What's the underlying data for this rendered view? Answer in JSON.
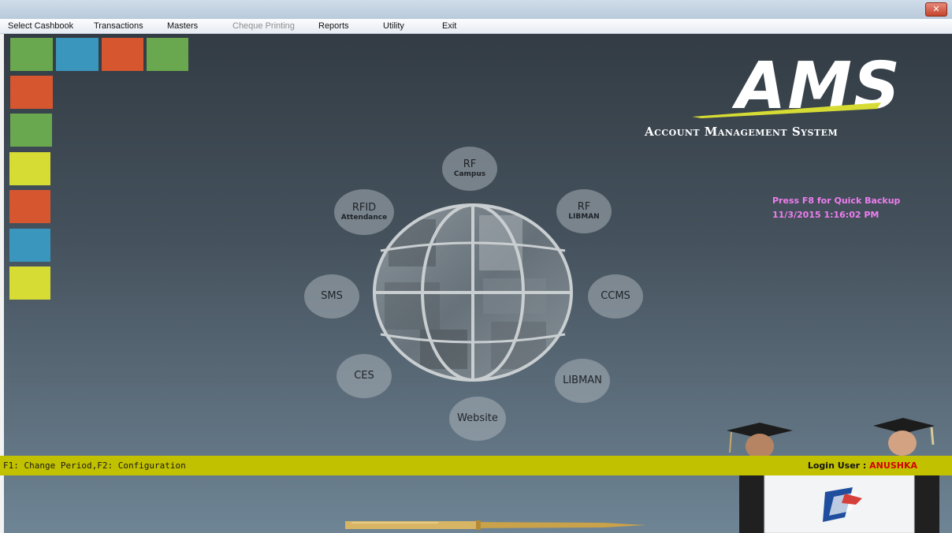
{
  "window": {
    "close_glyph": "✕"
  },
  "menu": {
    "items": [
      {
        "label": "Select Cashbook",
        "enabled": true
      },
      {
        "label": "Transactions",
        "enabled": true
      },
      {
        "label": "Masters",
        "enabled": true
      },
      {
        "label": "Cheque Printing",
        "enabled": false
      },
      {
        "label": "Reports",
        "enabled": true
      },
      {
        "label": "Utility",
        "enabled": true
      },
      {
        "label": "Exit",
        "enabled": true
      }
    ]
  },
  "colors": {
    "green": "#6aa84f",
    "blue": "#3a96bd",
    "orange": "#d65630",
    "yellow": "#d6dc34",
    "pink_text": "#ef7ef0",
    "status_bar": "#c2c100",
    "user_red": "#d40000"
  },
  "tiles": {
    "top_row": [
      "green",
      "blue",
      "orange",
      "green"
    ],
    "left_column": [
      "orange",
      "green",
      "yellow",
      "orange",
      "blue",
      "yellow"
    ]
  },
  "logo": {
    "title": "AMS",
    "subtitle": "Account Management System"
  },
  "info": {
    "backup_hint": "Press F8 for Quick Backup",
    "datetime": "11/3/2015 1:16:02 PM"
  },
  "modules": [
    {
      "id": "rf-campus",
      "line1": "RF",
      "line2": "Campus"
    },
    {
      "id": "rf-libman",
      "line1": "RF",
      "line2": "LIBMAN"
    },
    {
      "id": "ccms",
      "line1": "CCMS",
      "line2": ""
    },
    {
      "id": "libman",
      "line1": "LIBMAN",
      "line2": ""
    },
    {
      "id": "website",
      "line1": "Website",
      "line2": ""
    },
    {
      "id": "ces",
      "line1": "CES",
      "line2": ""
    },
    {
      "id": "sms",
      "line1": "SMS",
      "line2": ""
    },
    {
      "id": "rfid-attendance",
      "line1": "RFID",
      "line2": "Attendance"
    }
  ],
  "status": {
    "shortcuts": "F1: Change Period,F2: Configuration",
    "login_label": "Login User :",
    "login_user": "ANUSHKA"
  }
}
